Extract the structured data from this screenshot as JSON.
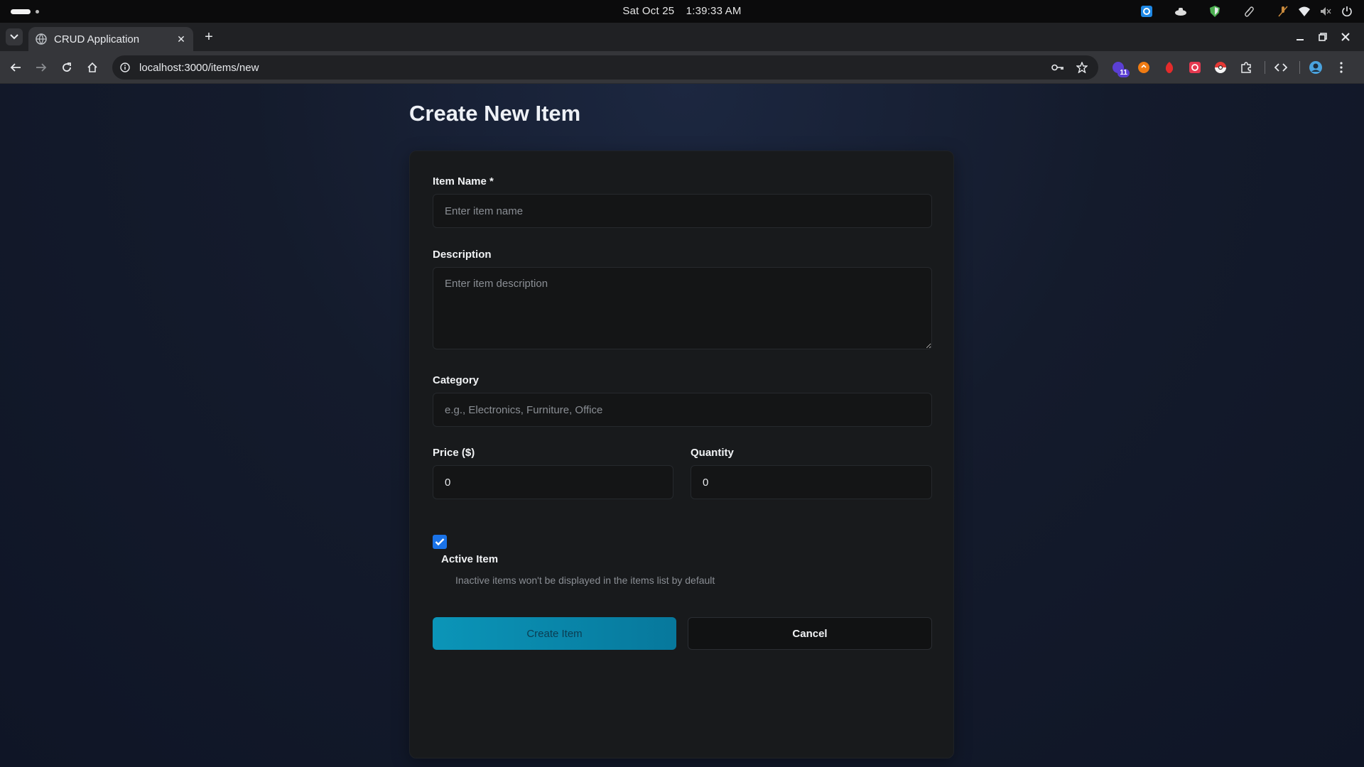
{
  "os": {
    "date": "Sat Oct 25",
    "time": "1:39:33 AM",
    "tray_icons": [
      "app-icon",
      "steam-icon",
      "shield-icon",
      "paperclip-icon",
      "mic-muted-icon",
      "wifi-icon",
      "volume-muted-icon",
      "power-icon"
    ]
  },
  "browser": {
    "tab_title": "CRUD Application",
    "url": "localhost:3000/items/new",
    "extension_badge": "11",
    "accent": "#1a73e8"
  },
  "page": {
    "title": "Create New Item",
    "form": {
      "name_label": "Item Name *",
      "name_placeholder": "Enter item name",
      "description_label": "Description",
      "description_placeholder": "Enter item description",
      "category_label": "Category",
      "category_placeholder": "e.g., Electronics, Furniture, Office",
      "price_label": "Price ($)",
      "price_value": "0",
      "quantity_label": "Quantity",
      "quantity_value": "0",
      "active_checked": true,
      "active_label": "Active Item",
      "active_hint": "Inactive items won't be displayed in the items list by default",
      "create_label": "Create Item",
      "cancel_label": "Cancel",
      "primary_color": "#0b95b8"
    }
  }
}
